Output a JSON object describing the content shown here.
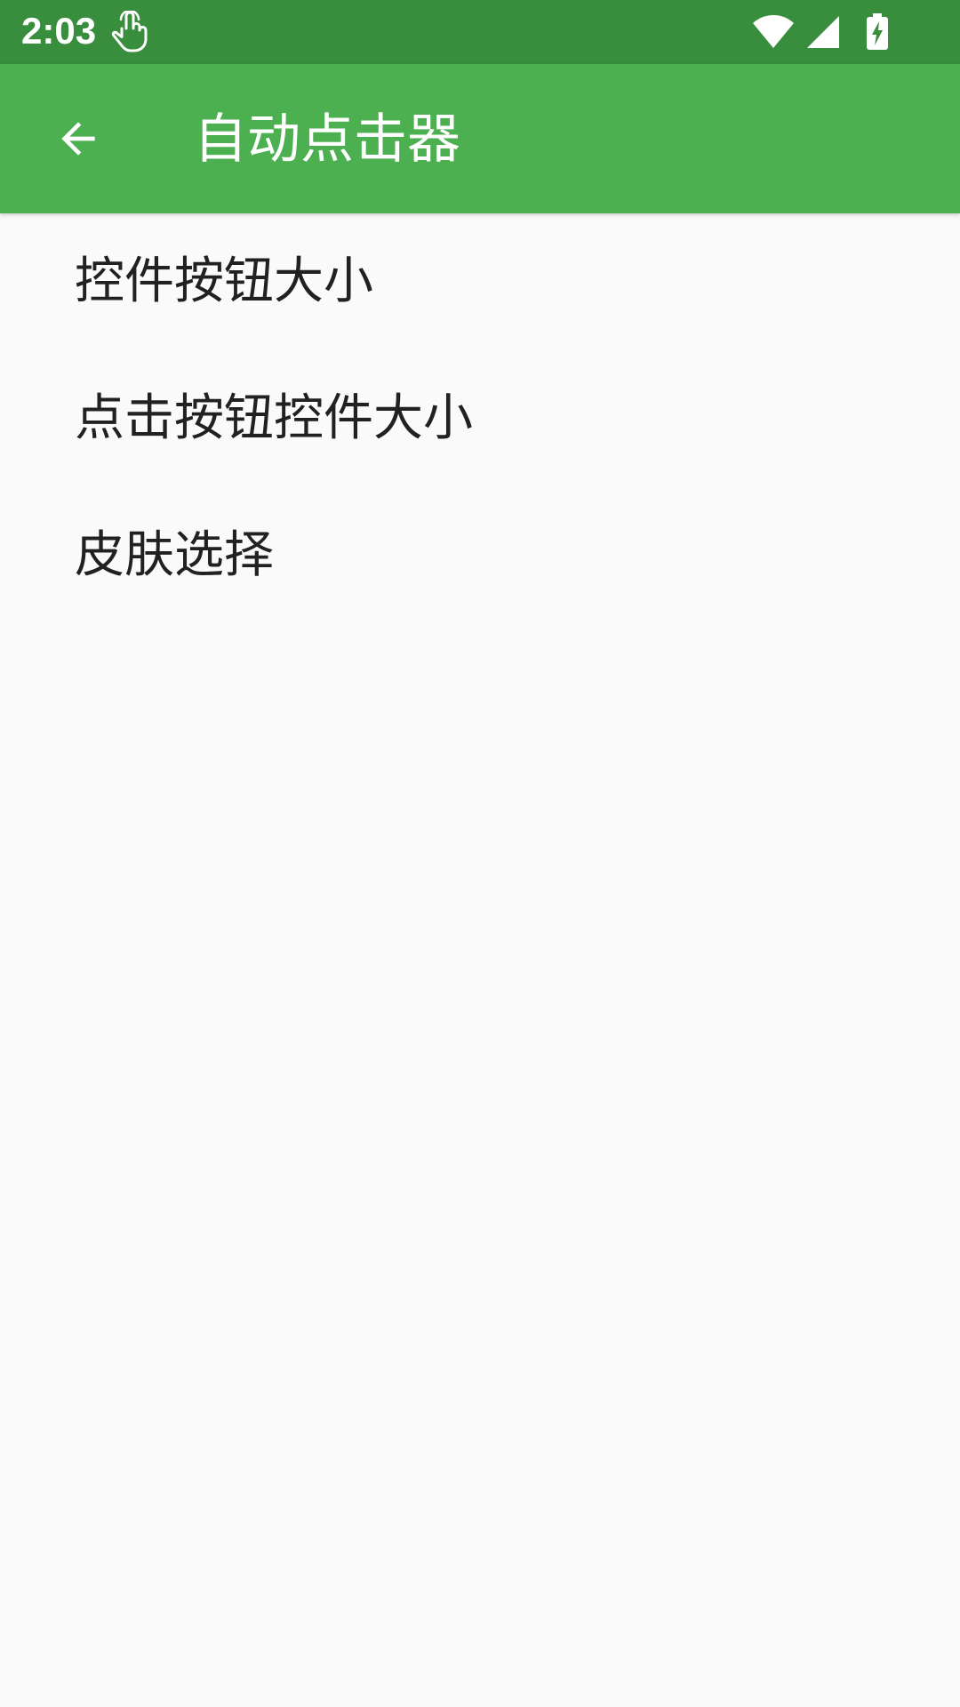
{
  "status_bar": {
    "time": "2:03",
    "icons": [
      "touch-icon",
      "wifi-icon",
      "cellular-signal-icon",
      "battery-charging-icon"
    ],
    "background_color": "#388E3C"
  },
  "app_bar": {
    "title": "自动点击器",
    "back_icon": "arrow-back-icon",
    "background_color": "#4CAF50"
  },
  "settings": {
    "items": [
      {
        "label": "控件按钮大小"
      },
      {
        "label": "点击按钮控件大小"
      },
      {
        "label": "皮肤选择"
      }
    ]
  }
}
